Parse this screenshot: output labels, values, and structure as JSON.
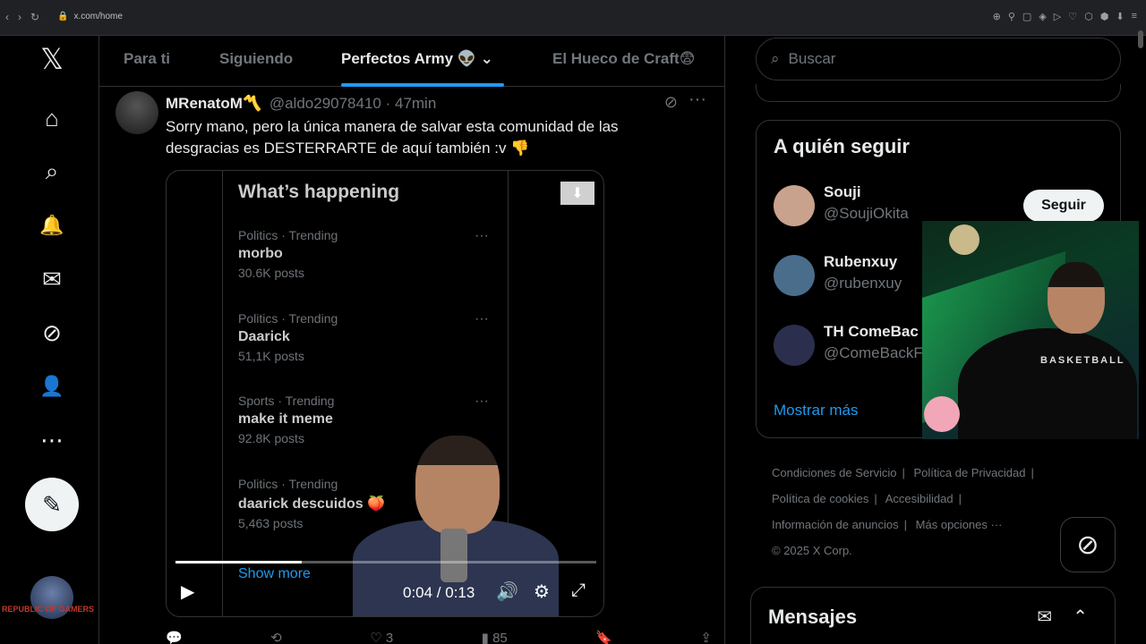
{
  "browser": {
    "url": "x.com/home",
    "nav": [
      "‹",
      "›",
      "↻"
    ],
    "tools": [
      "⊕",
      "⚲",
      "▢",
      "◈",
      "▷",
      "♡",
      "⬡",
      "⬢",
      "⬇",
      "≡"
    ]
  },
  "leftnav": {
    "items": [
      {
        "icon": "x-logo-icon",
        "glyph": "𝕏"
      },
      {
        "icon": "home-icon",
        "glyph": "⌂"
      },
      {
        "icon": "search-icon",
        "glyph": "⌕"
      },
      {
        "icon": "bell-icon",
        "glyph": "🔔"
      },
      {
        "icon": "mail-icon",
        "glyph": "✉"
      },
      {
        "icon": "grok-icon",
        "glyph": "⊘"
      },
      {
        "icon": "profile-icon",
        "glyph": "👤"
      },
      {
        "icon": "more-icon",
        "glyph": "⋯"
      }
    ],
    "compose_glyph": "✎",
    "overlay_logo_text": "REPUBLIC OF GAMERS"
  },
  "tabs": [
    {
      "label": "Para ti"
    },
    {
      "label": "Siguiendo"
    },
    {
      "label": "Perfectos Army 👽 ⌄"
    },
    {
      "label": "El Hueco de Craft😨"
    }
  ],
  "tweet": {
    "name": "MRenatoM〽️",
    "handle": "@aldo29078410 · 47min",
    "text": "Sorry mano, pero la única manera de salvar esta comunidad de las desgracias es DESTERRARTE de aquí también :v 👎",
    "more": "···",
    "grok": "⊘",
    "media": {
      "panel_title": "What’s happening",
      "trends": [
        {
          "category": "Politics · Trending",
          "title": "morbo",
          "count": "30.6K posts"
        },
        {
          "category": "Politics · Trending",
          "title": "Daarick",
          "count": "51,1K posts"
        },
        {
          "category": "Sports · Trending",
          "title": "make it meme",
          "count": "92.8K posts"
        },
        {
          "category": "Politics · Trending",
          "title": "daarick descuidos 🍑",
          "count": "5,463 posts"
        }
      ],
      "trend_dots": "···",
      "show_more": "Show more",
      "time": "0:04 / 0:13",
      "progress": 0.3,
      "play": "▶",
      "volume": "🔊",
      "settings": "⚙",
      "fullscreen": "⤢"
    },
    "actions": [
      {
        "icon": "reply-icon",
        "glyph": "💬",
        "count": ""
      },
      {
        "icon": "repost-icon",
        "glyph": "⟲",
        "count": ""
      },
      {
        "icon": "like-icon",
        "glyph": "♡",
        "count": "3"
      },
      {
        "icon": "views-icon",
        "glyph": "▮",
        "count": "85"
      },
      {
        "icon": "bookmark-icon",
        "glyph": "🔖",
        "count": ""
      },
      {
        "icon": "share-icon",
        "glyph": "⇪",
        "count": ""
      }
    ]
  },
  "right": {
    "search_placeholder": "Buscar",
    "follow_title": "A quién seguir",
    "users": [
      {
        "name": "Souji",
        "handle": "@SoujiOkita",
        "color": "#c9a28d"
      },
      {
        "name": "Rubenxuy",
        "handle": "@rubenxuy",
        "color": "#4a6d8c"
      },
      {
        "name": "TH ComeBac",
        "handle": "@ComeBackF",
        "color": "#2b2f4d"
      }
    ],
    "follow_btn": "Seguir",
    "show_more": "Mostrar más",
    "footer": [
      "Condiciones de Servicio",
      "|",
      "Política de Privacidad",
      "|",
      "Política de cookies",
      "|",
      "Accesibilidad",
      "|",
      "Información de anuncios",
      "|",
      "Más opciones ···",
      "© 2025 X Corp."
    ],
    "messages_title": "Mensajes",
    "messages_icons": [
      "✉",
      "⌃"
    ]
  },
  "webcam": {
    "hoodie_text": "BASKETBALL"
  }
}
